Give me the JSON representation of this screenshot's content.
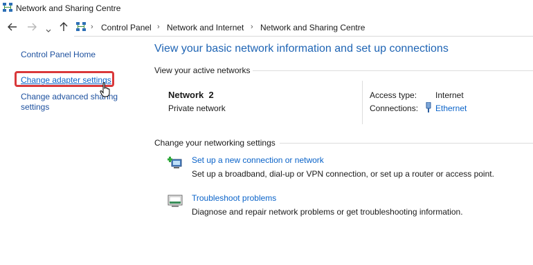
{
  "window": {
    "title": "Network and Sharing Centre"
  },
  "address_bar": {
    "crumbs": [
      "Control Panel",
      "Network and Internet",
      "Network and Sharing Centre"
    ]
  },
  "sidebar": {
    "home_link": "Control Panel Home",
    "change_adapter": "Change adapter settings",
    "change_sharing_line1": "Change advanced sharing",
    "change_sharing_line2": "settings"
  },
  "main": {
    "heading": "View your basic network information and set up connections",
    "active_networks_label": "View your active networks",
    "network": {
      "name": "Network  2",
      "type": "Private network",
      "access_type_label": "Access type:",
      "access_type_value": "Internet",
      "connections_label": "Connections:",
      "connections_value": "Ethernet"
    },
    "change_settings_label": "Change your networking settings",
    "tasks": [
      {
        "title": "Set up a new connection or network",
        "description": "Set up a broadband, dial-up or VPN connection, or set up a router or access point."
      },
      {
        "title": "Troubleshoot problems",
        "description": "Diagnose and repair network problems or get troubleshooting information."
      }
    ]
  },
  "colors": {
    "link": "#0a63c9",
    "heading": "#1e64b4",
    "highlight": "#d9383a"
  },
  "icons": [
    "network-icon",
    "back-arrow-icon",
    "forward-arrow-icon",
    "chevron-down-icon",
    "up-arrow-icon",
    "control-panel-icon",
    "hand-cursor-icon",
    "ethernet-icon",
    "new-connection-icon",
    "troubleshoot-icon"
  ]
}
